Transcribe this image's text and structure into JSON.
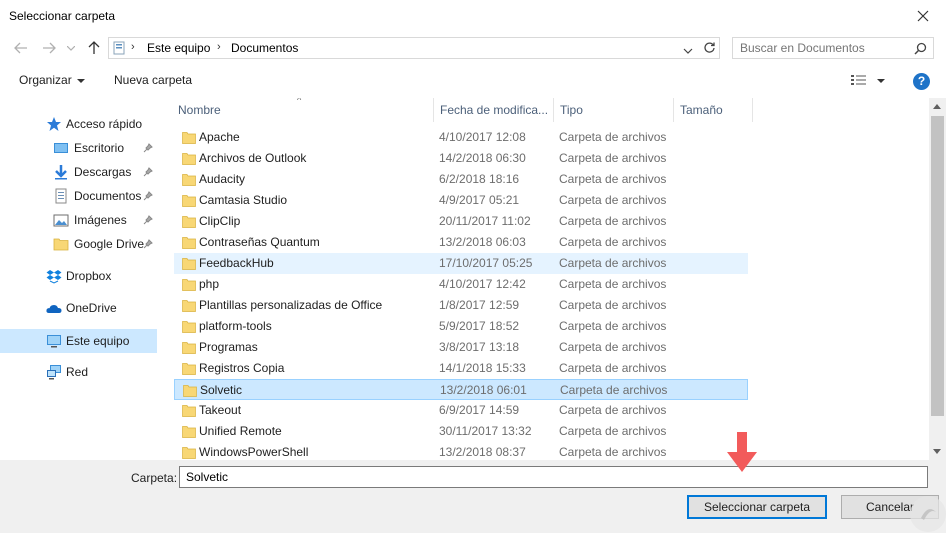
{
  "window": {
    "title": "Seleccionar carpeta"
  },
  "address": {
    "crumbs": [
      "Este equipo",
      "Documentos"
    ],
    "search_placeholder": "Buscar en Documentos"
  },
  "toolbar": {
    "organize_label": "Organizar",
    "new_folder_label": "Nueva carpeta",
    "help_label": "?"
  },
  "sidebar": {
    "items": [
      {
        "label": "Acceso rápido",
        "icon": "star-icon",
        "pinned": false
      },
      {
        "label": "Escritorio",
        "icon": "desktop-icon",
        "pinned": true
      },
      {
        "label": "Descargas",
        "icon": "download-icon",
        "pinned": true
      },
      {
        "label": "Documentos",
        "icon": "document-icon",
        "pinned": true
      },
      {
        "label": "Imágenes",
        "icon": "pictures-icon",
        "pinned": true
      },
      {
        "label": "Google Drive",
        "icon": "folder-icon",
        "pinned": true
      },
      {
        "label": "Dropbox",
        "icon": "dropbox-icon",
        "pinned": false
      },
      {
        "label": "OneDrive",
        "icon": "onedrive-icon",
        "pinned": false
      },
      {
        "label": "Este equipo",
        "icon": "computer-icon",
        "pinned": false,
        "selected": true
      },
      {
        "label": "Red",
        "icon": "network-icon",
        "pinned": false
      }
    ]
  },
  "list": {
    "columns": [
      "Nombre",
      "Fecha de modifica...",
      "Tipo",
      "Tamaño"
    ],
    "rows": [
      {
        "name": "Apache",
        "date": "4/10/2017 12:08",
        "type": "Carpeta de archivos"
      },
      {
        "name": "Archivos de Outlook",
        "date": "14/2/2018 06:30",
        "type": "Carpeta de archivos"
      },
      {
        "name": "Audacity",
        "date": "6/2/2018 18:16",
        "type": "Carpeta de archivos"
      },
      {
        "name": "Camtasia Studio",
        "date": "4/9/2017 05:21",
        "type": "Carpeta de archivos"
      },
      {
        "name": "ClipClip",
        "date": "20/11/2017 11:02",
        "type": "Carpeta de archivos"
      },
      {
        "name": "Contraseñas Quantum",
        "date": "13/2/2018 06:03",
        "type": "Carpeta de archivos"
      },
      {
        "name": "FeedbackHub",
        "date": "17/10/2017 05:25",
        "type": "Carpeta de archivos",
        "state": "hover"
      },
      {
        "name": "php",
        "date": "4/10/2017 12:42",
        "type": "Carpeta de archivos"
      },
      {
        "name": "Plantillas personalizadas de Office",
        "date": "1/8/2017 12:59",
        "type": "Carpeta de archivos"
      },
      {
        "name": "platform-tools",
        "date": "5/9/2017 18:52",
        "type": "Carpeta de archivos"
      },
      {
        "name": "Programas",
        "date": "3/8/2017 13:18",
        "type": "Carpeta de archivos"
      },
      {
        "name": "Registros Copia",
        "date": "14/1/2018 15:33",
        "type": "Carpeta de archivos"
      },
      {
        "name": "Solvetic",
        "date": "13/2/2018 06:01",
        "type": "Carpeta de archivos",
        "state": "selected"
      },
      {
        "name": "Takeout",
        "date": "6/9/2017 14:59",
        "type": "Carpeta de archivos"
      },
      {
        "name": "Unified Remote",
        "date": "30/11/2017 13:32",
        "type": "Carpeta de archivos"
      },
      {
        "name": "WindowsPowerShell",
        "date": "13/2/2018 08:37",
        "type": "Carpeta de archivos"
      }
    ]
  },
  "footer": {
    "folder_label": "Carpeta:",
    "folder_value": "Solvetic",
    "select_label": "Seleccionar carpeta",
    "cancel_label": "Cancelar"
  },
  "colors": {
    "accent": "#0078d7",
    "selection": "#cce8ff",
    "hover": "#e5f3ff",
    "folder": "#f8d775",
    "annotation": "#f25b5b"
  }
}
